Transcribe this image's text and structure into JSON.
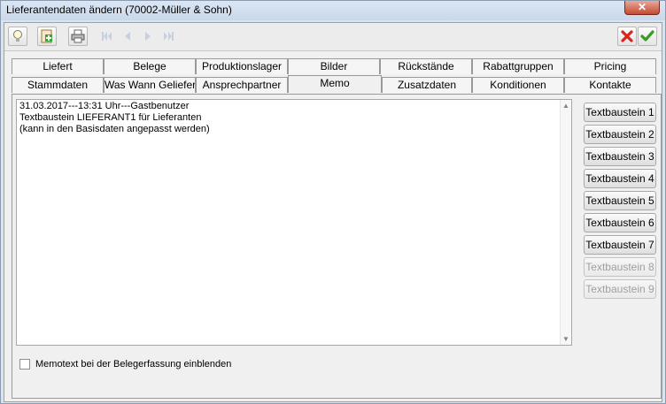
{
  "window": {
    "title": "Lieferantendaten ändern (70002-Müller & Sohn)",
    "close_glyph": "✕"
  },
  "toolbar": {
    "buttons": [
      {
        "name": "hint-bulb-icon"
      },
      {
        "name": "add-document-icon"
      },
      {
        "name": "print-icon"
      },
      {
        "name": "first-record-icon"
      },
      {
        "name": "previous-record-icon"
      },
      {
        "name": "next-record-icon"
      },
      {
        "name": "last-record-icon"
      },
      {
        "name": "cancel-icon"
      },
      {
        "name": "confirm-icon"
      }
    ]
  },
  "tabs": {
    "row_back": [
      "Liefert",
      "Belege",
      "Produktionslager",
      "Bilder",
      "Rückstände",
      "Rabattgruppen",
      "Pricing"
    ],
    "row_front": [
      "Stammdaten",
      "Was Wann Geliefert",
      "Ansprechpartner",
      "Memo",
      "Zusatzdaten",
      "Konditionen",
      "Kontakte"
    ],
    "active": "Memo"
  },
  "memo": {
    "text": "31.03.2017---13:31 Uhr---Gastbenutzer\nTextbaustein LIEFERANT1 für Lieferanten\n(kann in den Basisdaten angepasst werden)"
  },
  "textbausteine": [
    {
      "label": "Textbaustein 1",
      "enabled": true
    },
    {
      "label": "Textbaustein 2",
      "enabled": true
    },
    {
      "label": "Textbaustein 3",
      "enabled": true
    },
    {
      "label": "Textbaustein 4",
      "enabled": true
    },
    {
      "label": "Textbaustein 5",
      "enabled": true
    },
    {
      "label": "Textbaustein 6",
      "enabled": true
    },
    {
      "label": "Textbaustein 7",
      "enabled": true
    },
    {
      "label": "Textbaustein 8",
      "enabled": false
    },
    {
      "label": "Textbaustein 9",
      "enabled": false
    }
  ],
  "checkbox": {
    "label": "Memotext bei der Belegerfassung einblenden",
    "checked": false
  },
  "colors": {
    "cancel": "#d9261c",
    "confirm": "#3a9a2a"
  }
}
